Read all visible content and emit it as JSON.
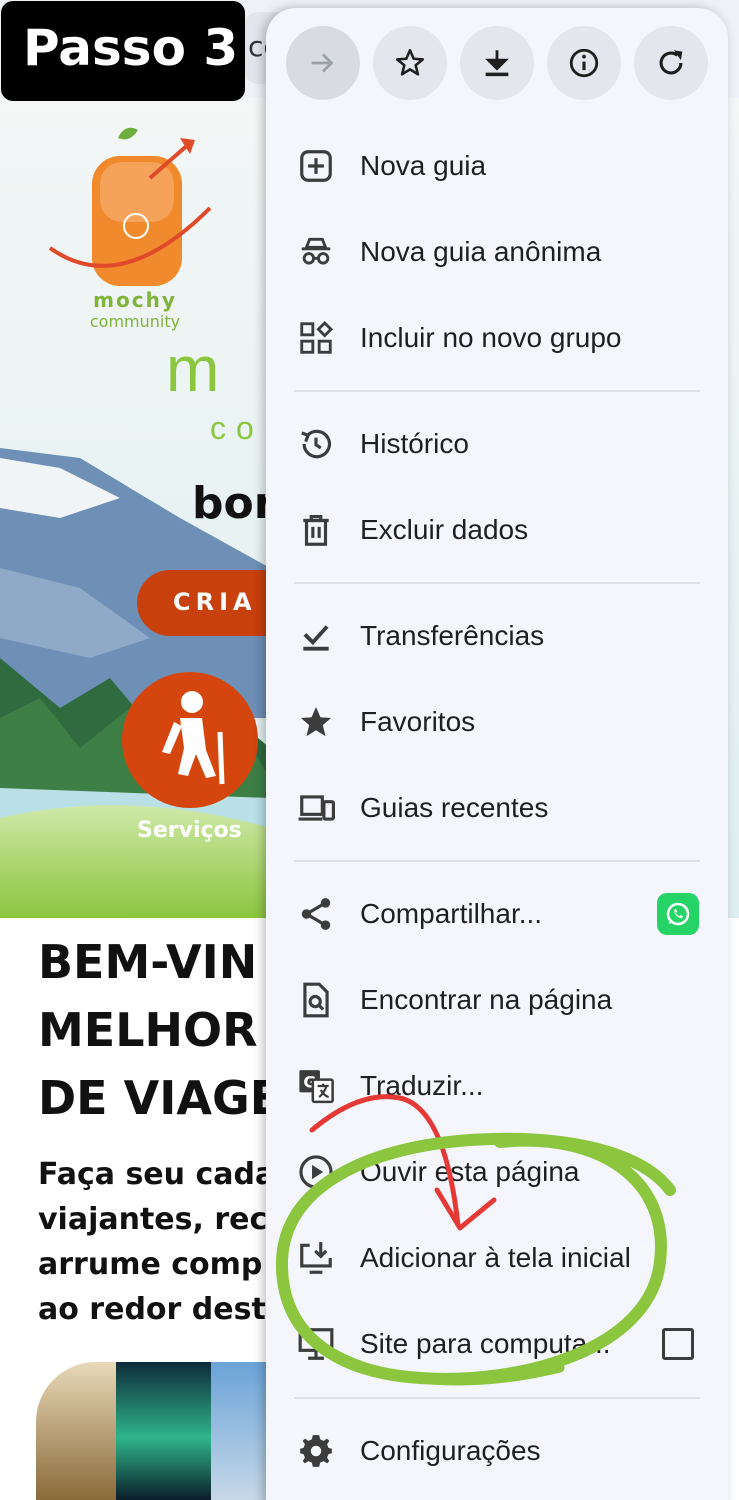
{
  "step_badge": "Passo 3",
  "background_page": {
    "url_fragment": "co",
    "logo_name": "mochy",
    "logo_sub": "community",
    "hero_title_fragment": "m",
    "hero_sub_fragment": "co",
    "greeting_fragment": "bor",
    "cta_fragment": "CRIA",
    "service_label": "Serviços",
    "welcome_lines": [
      "BEM-VIN",
      "MELHOR",
      "DE VIAGE"
    ],
    "sub_lines": [
      "Faça seu cada",
      "viajantes, reco",
      "arrume comp",
      "ao redor deste"
    ],
    "colors": {
      "cta": "#c8400c",
      "brand_green": "#8cc63f"
    }
  },
  "menu": {
    "top_actions": [
      {
        "name": "forward-icon"
      },
      {
        "name": "bookmark-star-icon"
      },
      {
        "name": "download-icon"
      },
      {
        "name": "info-icon"
      },
      {
        "name": "reload-icon"
      }
    ],
    "items": [
      {
        "label": "Nova guia",
        "icon": "new-tab-icon"
      },
      {
        "label": "Nova guia anônima",
        "icon": "incognito-icon"
      },
      {
        "label": "Incluir no novo grupo",
        "icon": "tab-group-icon"
      },
      {
        "label": "Histórico",
        "icon": "history-icon"
      },
      {
        "label": "Excluir dados",
        "icon": "trash-icon"
      },
      {
        "label": "Transferências",
        "icon": "downloads-check-icon"
      },
      {
        "label": "Favoritos",
        "icon": "star-icon"
      },
      {
        "label": "Guias recentes",
        "icon": "devices-icon"
      },
      {
        "label": "Compartilhar...",
        "icon": "share-icon"
      },
      {
        "label": "Encontrar na página",
        "icon": "find-in-page-icon"
      },
      {
        "label": "Traduzir...",
        "icon": "translate-icon"
      },
      {
        "label": "Ouvir esta página",
        "icon": "play-circle-icon"
      },
      {
        "label": "Adicionar à tela inicial",
        "icon": "add-to-home-icon"
      },
      {
        "label": "Site para computa...",
        "icon": "desktop-icon",
        "checked": false
      },
      {
        "label": "Configurações",
        "icon": "gear-icon"
      }
    ],
    "colors": {
      "menu_bg": "#f4f6fb",
      "whatsapp": "#25d366",
      "annotation_green": "#8cc63f",
      "annotation_red": "#e53935"
    }
  }
}
